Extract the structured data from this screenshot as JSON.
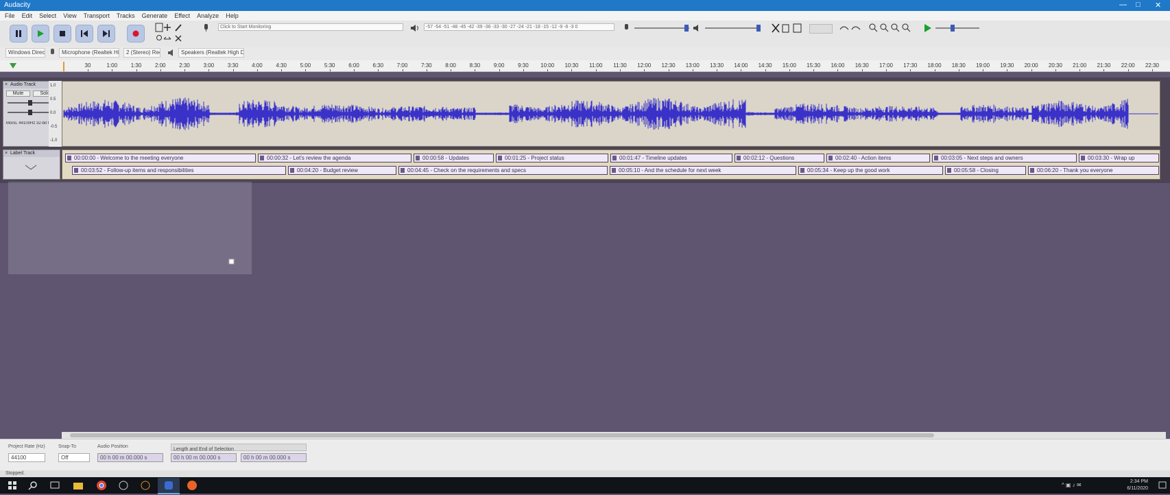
{
  "window": {
    "title": "Audacity"
  },
  "menu": [
    "File",
    "Edit",
    "Select",
    "View",
    "Transport",
    "Tracks",
    "Generate",
    "Effect",
    "Analyze",
    "Help"
  ],
  "toolbar": {
    "record_meter_hint": "Click to Start Monitoring",
    "playback_meter_scale": "-57 -54 -51 -48 -45 -42 -39 -36 -33 -30 -27 -24 -21 -18 -15 -12 -9 -6 -3 0",
    "record_meter_scale": "-57 -54 -51 -48 -45 -42 -39 -36 -33 -30 -27 -24 -21 -18 -15 -12 -9 -6 -3 0"
  },
  "devices": {
    "host": "Windows DirectSound",
    "recording_device": "Microphone (Realtek High Definition Audio)",
    "recording_channels": "2 (Stereo) Recording Channels",
    "playback_device": "Speakers (Realtek High Definition Audio)"
  },
  "ruler": {
    "ticks": [
      "30",
      "1:00",
      "1:30",
      "2:00",
      "2:30",
      "3:00",
      "3:30",
      "4:00",
      "4:30",
      "5:00",
      "5:30",
      "6:00",
      "6:30",
      "7:00",
      "7:30",
      "8:00",
      "8:30",
      "9:00",
      "9:30",
      "10:00",
      "10:30",
      "11:00",
      "11:30",
      "12:00",
      "12:30",
      "13:00",
      "13:30",
      "14:00",
      "14:30",
      "15:00",
      "15:30",
      "16:00",
      "16:30",
      "17:00",
      "17:30",
      "18:00",
      "18:30",
      "19:00",
      "19:30",
      "20:00",
      "20:30",
      "21:00",
      "21:30",
      "22:00",
      "22:30"
    ]
  },
  "audio_track": {
    "name": "Audio Track",
    "mute": "Mute",
    "solo": "Solo",
    "format": "Mono, 44100Hz 32-bit float",
    "scale": [
      "1.0",
      "0.5",
      "0.0",
      "-0.5",
      "-1.0"
    ]
  },
  "label_track": {
    "name": "Label Track",
    "row1": [
      "00:00:00 - Welcome to the meeting everyone",
      "00:00:32 - Let's review the agenda",
      "00:00:58 - Updates",
      "00:01:25 - Project status",
      "00:01:47 - Timeline updates",
      "00:02:12 - Questions",
      "00:02:40 - Action items",
      "00:03:05 - Next steps and owners",
      "00:03:30 - Wrap up"
    ],
    "row2": [
      "00:03:52 - Follow-up items and responsibilities",
      "00:04:20 - Budget review",
      "00:04:45 - Check on the requirements and specs",
      "00:05:10 - And the schedule for next week",
      "00:05:34 - Keep up the good work",
      "00:05:58 - Closing",
      "00:06:20 - Thank you everyone"
    ]
  },
  "selection": {
    "rate_label": "Project Rate (Hz)",
    "rate_value": "44100",
    "snap_label": "Snap-To",
    "snap_value": "Off",
    "audio_position_label": "Audio Position",
    "audio_position_value": "00 h 00 m 00.000 s",
    "selection_label": "Length and End of Selection",
    "selection_start": "00 h 00 m 00.000 s",
    "selection_end": "00 h 00 m 00.000 s"
  },
  "status": {
    "text": "Stopped."
  },
  "taskbar": {
    "time": "2:34 PM",
    "date": "6/11/2020"
  },
  "colors": {
    "waveform": "#3a32c8",
    "track_bg": "#dad5c8",
    "label_bg": "#efe8f6",
    "workspace": "#5f5570"
  }
}
